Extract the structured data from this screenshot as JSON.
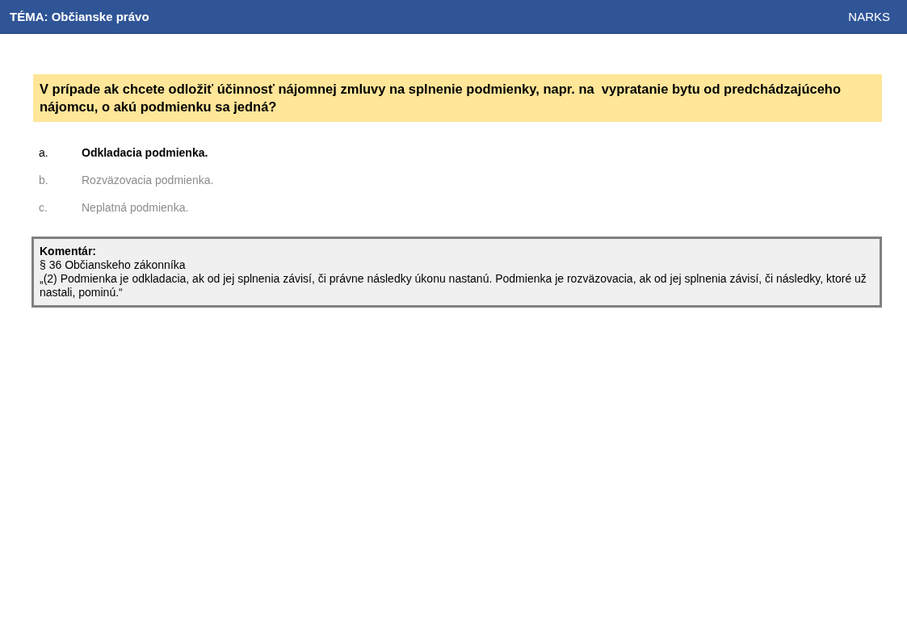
{
  "header": {
    "topic": "TÉMA: Občianske právo",
    "brand": "NARKS"
  },
  "question": "V prípade ak chcete odložiť účinnosť nájomnej zmluvy na splnenie podmienky, napr. na  vypratanie bytu od predchádzajúceho nájomcu, o akú podmienku sa jedná?",
  "answers": [
    {
      "letter": "a.",
      "text": "Odkladacia podmienka.",
      "selected": true
    },
    {
      "letter": "b.",
      "text": "Rozväzovacia podmienka.",
      "selected": false
    },
    {
      "letter": "c.",
      "text": "Neplatná podmienka.",
      "selected": false
    }
  ],
  "comment": {
    "title": "Komentár:",
    "source": "§ 36 Občianskeho zákonníka",
    "text": "„(2) Podmienka je odkladacia, ak od jej splnenia závisí, či právne následky úkonu nastanú. Podmienka je rozväzovacia, ak od jej splnenia závisí, či následky, ktoré už nastali, pominú.“"
  }
}
